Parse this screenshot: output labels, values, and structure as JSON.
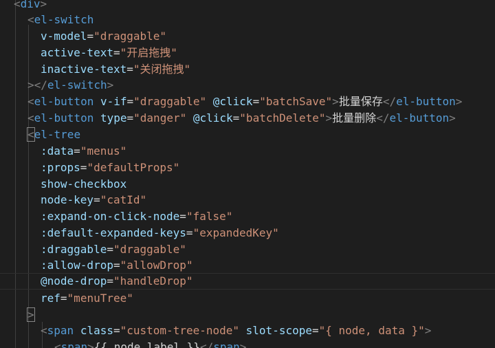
{
  "editor": {
    "language": "vue-html",
    "theme_colors": {
      "background": "#1e1e1e",
      "tag": "#569cd6",
      "attribute": "#9cdcfe",
      "string": "#ce9178",
      "punctuation": "#808080",
      "text": "#d4d4d4"
    },
    "lines": [
      {
        "tag": "div"
      },
      {
        "tag": "el-switch"
      },
      {
        "attr": "v-model",
        "eq": "=",
        "val": "\"draggable\""
      },
      {
        "attr": "active-text",
        "eq": "=",
        "val": "\"开启拖拽\""
      },
      {
        "attr": "inactive-text",
        "eq": "=",
        "val": "\"关闭拖拽\""
      },
      {
        "gt": ">",
        "close_open": "</",
        "tag": "el-switch",
        "close": ">"
      },
      {
        "tag": "el-button",
        "attr": "v-if",
        "eq": "=",
        "val": "\"draggable\"",
        "attr2": "@click",
        "eq2": "=",
        "val2": "\"batchSave\"",
        "text": "批量保存",
        "close_tag": "el-button"
      },
      {
        "tag": "el-button",
        "attr": "type",
        "eq": "=",
        "val": "\"danger\"",
        "attr2": "@click",
        "eq2": "=",
        "val2": "\"batchDelete\"",
        "text": "批量删除",
        "close_tag": "el-button"
      },
      {
        "tag": "el-tree"
      },
      {
        "attr": ":data",
        "eq": "=",
        "val": "\"menus\""
      },
      {
        "attr": ":props",
        "eq": "=",
        "val": "\"defaultProps\""
      },
      {
        "attr": "show-checkbox"
      },
      {
        "attr": "node-key",
        "eq": "=",
        "val": "\"catId\""
      },
      {
        "attr": ":expand-on-click-node",
        "eq": "=",
        "val": "\"false\""
      },
      {
        "attr": ":default-expanded-keys",
        "eq": "=",
        "val": "\"expandedKey\""
      },
      {
        "attr": ":draggable",
        "eq": "=",
        "val": "\"draggable\""
      },
      {
        "attr": ":allow-drop",
        "eq": "=",
        "val": "\"allowDrop\""
      },
      {
        "attr": "@node-drop",
        "eq": "=",
        "val": "\"handleDrop\""
      },
      {
        "attr": "ref",
        "eq": "=",
        "val": "\"menuTree\""
      },
      {
        "gt": ">"
      },
      {
        "tag": "span",
        "attr": "class",
        "eq": "=",
        "val": "\"custom-tree-node\"",
        "attr2": "slot-scope",
        "eq2": "=",
        "val2": "\"{ node, data }\""
      },
      {
        "tag": "span",
        "text": "{{ node.label }}",
        "close_tag": "span"
      }
    ]
  }
}
